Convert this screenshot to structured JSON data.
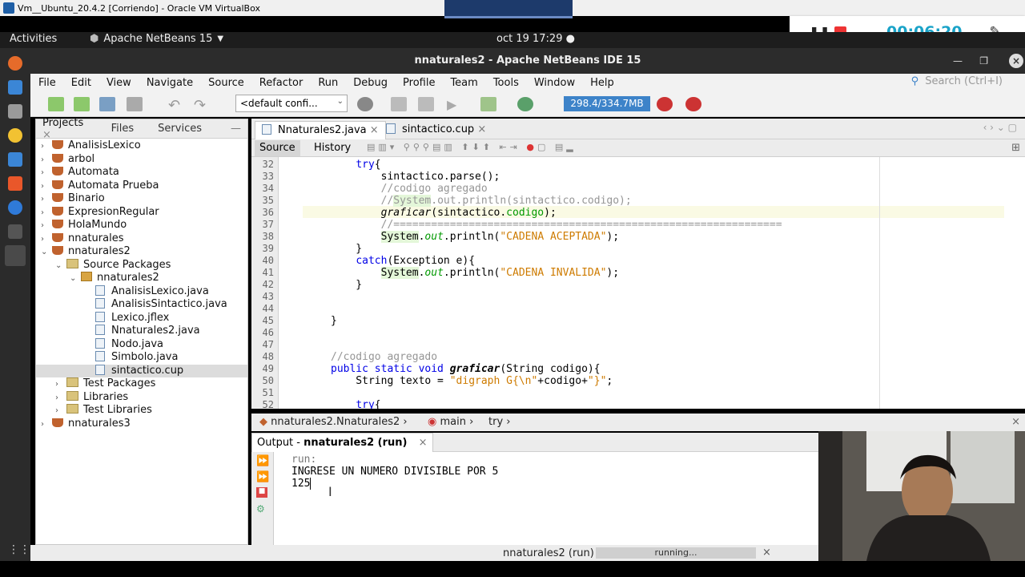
{
  "vbox": {
    "title": "Vm__Ubuntu_20.4.2 [Corriendo] - Oracle VM VirtualBox"
  },
  "recorder": {
    "timer": "00:06:20"
  },
  "gnome": {
    "activities": "Activities",
    "app": "Apache NetBeans 15",
    "clock": "oct 19  17:29"
  },
  "window": {
    "title": "nnaturales2 - Apache NetBeans IDE 15"
  },
  "menu": [
    "File",
    "Edit",
    "View",
    "Navigate",
    "Source",
    "Refactor",
    "Run",
    "Debug",
    "Profile",
    "Team",
    "Tools",
    "Window",
    "Help"
  ],
  "search": {
    "placeholder": "Search (Ctrl+I)"
  },
  "toolbar": {
    "config": "<default confi...",
    "memory": "298.4/334.7MB"
  },
  "projects": {
    "tabs": [
      "Projects",
      "Files",
      "Services"
    ],
    "tree": [
      {
        "label": "AnalisisLexico",
        "kind": "project",
        "arrow": "›",
        "indent": 0
      },
      {
        "label": "arbol",
        "kind": "project",
        "arrow": "›",
        "indent": 0
      },
      {
        "label": "Automata",
        "kind": "project",
        "arrow": "›",
        "indent": 0
      },
      {
        "label": "Automata Prueba",
        "kind": "project",
        "arrow": "›",
        "indent": 0
      },
      {
        "label": "Binario",
        "kind": "project",
        "arrow": "›",
        "indent": 0
      },
      {
        "label": "ExpresionRegular",
        "kind": "project",
        "arrow": "›",
        "indent": 0
      },
      {
        "label": "HolaMundo",
        "kind": "project",
        "arrow": "›",
        "indent": 0
      },
      {
        "label": "nnaturales",
        "kind": "project",
        "arrow": "›",
        "indent": 0
      },
      {
        "label": "nnaturales2",
        "kind": "project",
        "arrow": "⌄",
        "indent": 0
      },
      {
        "label": "Source Packages",
        "kind": "folder",
        "arrow": "⌄",
        "indent": 1
      },
      {
        "label": "nnaturales2",
        "kind": "package",
        "arrow": "⌄",
        "indent": 2
      },
      {
        "label": "AnalisisLexico.java",
        "kind": "file",
        "arrow": "",
        "indent": 3
      },
      {
        "label": "AnalisisSintactico.java",
        "kind": "file",
        "arrow": "",
        "indent": 3
      },
      {
        "label": "Lexico.jflex",
        "kind": "file",
        "arrow": "",
        "indent": 3
      },
      {
        "label": "Nnaturales2.java",
        "kind": "file",
        "arrow": "",
        "indent": 3
      },
      {
        "label": "Nodo.java",
        "kind": "file",
        "arrow": "",
        "indent": 3
      },
      {
        "label": "Simbolo.java",
        "kind": "file",
        "arrow": "",
        "indent": 3
      },
      {
        "label": "sintactico.cup",
        "kind": "file",
        "arrow": "",
        "indent": 3,
        "selected": true
      },
      {
        "label": "Test Packages",
        "kind": "folder",
        "arrow": "›",
        "indent": 1
      },
      {
        "label": "Libraries",
        "kind": "folder",
        "arrow": "›",
        "indent": 1
      },
      {
        "label": "Test Libraries",
        "kind": "folder",
        "arrow": "›",
        "indent": 1
      },
      {
        "label": "nnaturales3",
        "kind": "project",
        "arrow": "›",
        "indent": 0
      }
    ]
  },
  "editor": {
    "tabs": [
      "Nnaturales2.java",
      "sintactico.cup"
    ],
    "source": "Source",
    "history": "History",
    "breadcrumb": [
      "nnaturales2.Nnaturales2",
      "main",
      "try"
    ]
  },
  "code": [
    {
      "n": "32",
      "html": "    <span class='kw'>try</span>{"
    },
    {
      "n": "33",
      "html": "        sintactico.parse();"
    },
    {
      "n": "34",
      "html": "        <span class='cm'>//codigo agregado</span>"
    },
    {
      "n": "35",
      "html": "        <span class='cm'>//<span class='hl'>System</span>.out.println(sintactico.codigo);</span>"
    },
    {
      "n": "36",
      "html": "        <span class='it'>graficar</span>(sintactico.<span class='fld'>codigo</span>);"
    },
    {
      "n": "37",
      "html": "        <span class='cm'>//==============================================================</span>"
    },
    {
      "n": "38",
      "html": "        <span class='hl'>System</span>.<span class='fld it'>out</span>.println(<span class='st'>\"CADENA ACEPTADA\"</span>);"
    },
    {
      "n": "39",
      "html": "    }"
    },
    {
      "n": "40",
      "html": "    <span class='kw'>catch</span>(Exception e){"
    },
    {
      "n": "41",
      "html": "        <span class='hl'>System</span>.<span class='fld it'>out</span>.println(<span class='st'>\"CADENA INVALIDA\"</span>);"
    },
    {
      "n": "42",
      "html": "    }"
    },
    {
      "n": "43",
      "html": ""
    },
    {
      "n": "44",
      "html": ""
    },
    {
      "n": "45",
      "html": "}"
    },
    {
      "n": "46",
      "html": ""
    },
    {
      "n": "47",
      "html": ""
    },
    {
      "n": "48",
      "html": "<span class='cm'>//codigo agregado</span>"
    },
    {
      "n": "49",
      "html": "<span class='kw'>public static void</span> <b class='it'>graficar</b>(String codigo){"
    },
    {
      "n": "50",
      "html": "    String texto = <span class='st'>\"digraph G{\\n\"</span>+codigo+<span class='st'>\"}\"</span>;"
    },
    {
      "n": "51",
      "html": ""
    },
    {
      "n": "52",
      "html": "    <span class='kw'>try</span>{"
    }
  ],
  "output": {
    "tab": "Output - ",
    "tab_bold": "nnaturales2 (run)",
    "lines": [
      "run:",
      "INGRESE UN NUMERO DIVISIBLE POR 5",
      "125"
    ]
  },
  "status": {
    "task": "nnaturales2 (run)",
    "progress": "running..."
  }
}
